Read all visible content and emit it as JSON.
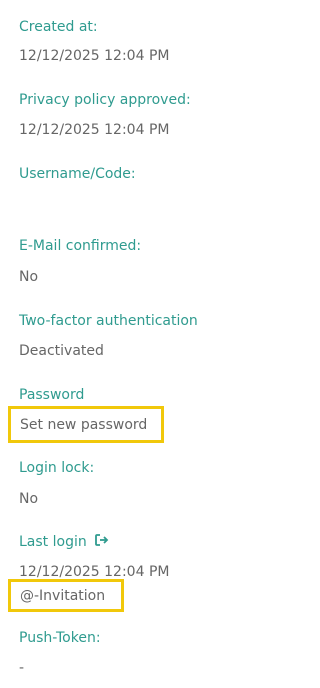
{
  "fields": {
    "created_at": {
      "label": "Created at:",
      "value": "12/12/2025 12:04 PM"
    },
    "privacy_policy": {
      "label": "Privacy policy approved:",
      "value": "12/12/2025 12:04 PM"
    },
    "username": {
      "label": "Username/Code:",
      "value": ""
    },
    "email_confirmed": {
      "label": "E-Mail confirmed:",
      "value": "No"
    },
    "two_factor": {
      "label": "Two-factor authentication",
      "value": "Deactivated"
    },
    "password": {
      "label": "Password",
      "action": "Set new password"
    },
    "login_lock": {
      "label": "Login lock:",
      "value": "No"
    },
    "last_login": {
      "label": "Last login",
      "icon": "sign-in-icon",
      "value": "12/12/2025 12:04 PM",
      "action": "@-Invitation"
    },
    "push_token": {
      "label": "Push-Token:",
      "value": "-"
    }
  },
  "colors": {
    "label": "#2f9b8f",
    "value": "#666666",
    "highlight": "#f1c80a"
  }
}
